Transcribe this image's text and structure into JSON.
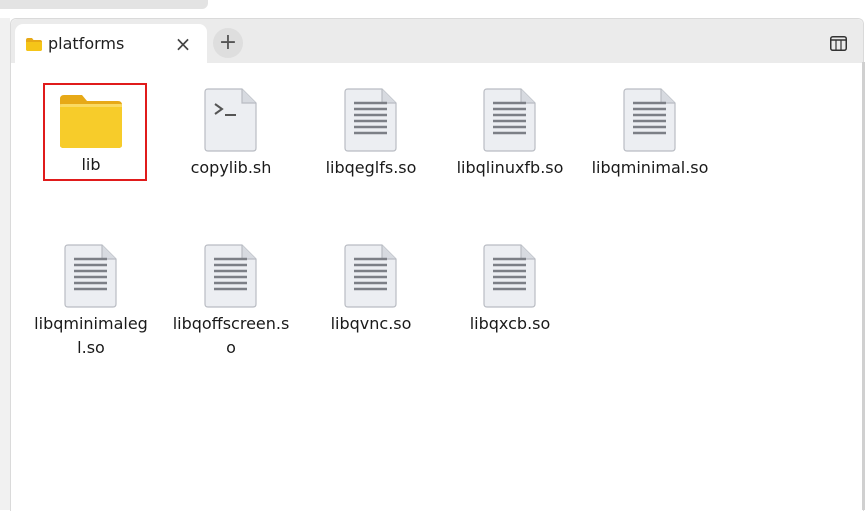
{
  "tab": {
    "title": "platforms",
    "close_glyph": "×",
    "new_tab_glyph": "+"
  },
  "files": [
    {
      "name": "lib",
      "type": "folder"
    },
    {
      "name": "copylib.sh",
      "type": "script"
    },
    {
      "name": "libqeglfs.so",
      "type": "document"
    },
    {
      "name": "libqlinuxfb.so",
      "type": "document"
    },
    {
      "name": "libqminimal.so",
      "type": "document"
    },
    {
      "name": "libqminimalegl.so",
      "type": "document"
    },
    {
      "name": "libqoffscreen.so",
      "type": "document"
    },
    {
      "name": "libqvnc.so",
      "type": "document"
    },
    {
      "name": "libqxcb.so",
      "type": "document"
    }
  ],
  "colors": {
    "folder": "#f5c518",
    "highlight": "#e01b1b"
  }
}
